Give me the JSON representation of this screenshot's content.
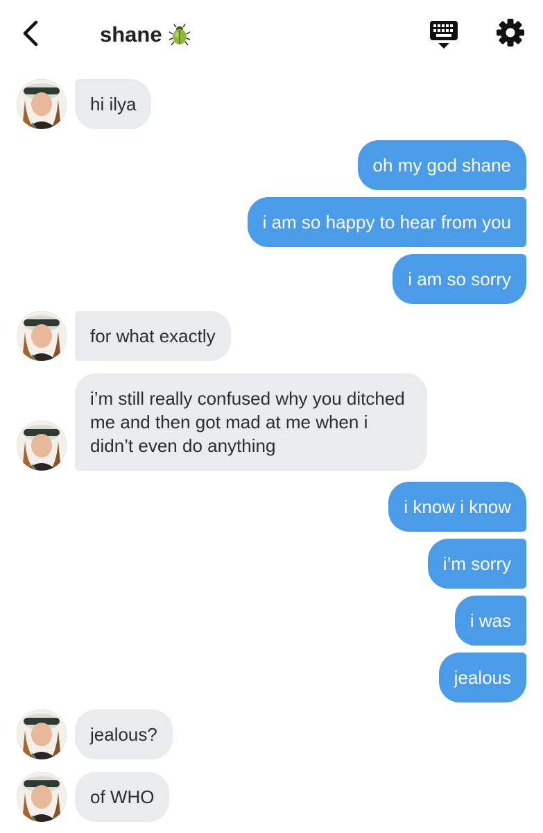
{
  "header": {
    "back_icon": "chevron-left-icon",
    "title": "shane",
    "title_emoji_icon": "beetle-icon",
    "keyboard_icon": "keyboard-icon",
    "settings_icon": "gear-icon"
  },
  "messages": [
    {
      "from": "them",
      "text": "hi ilya"
    },
    {
      "from": "me",
      "text": "oh my god shane"
    },
    {
      "from": "me",
      "text": "i am so happy to hear from you"
    },
    {
      "from": "me",
      "text": "i am so sorry"
    },
    {
      "from": "them",
      "text": "for what exactly"
    },
    {
      "from": "them",
      "text": "i’m still really confused why you ditched me and then got mad at me when i didn’t even do anything"
    },
    {
      "from": "me",
      "text": "i know i know"
    },
    {
      "from": "me",
      "text": "i’m sorry"
    },
    {
      "from": "me",
      "text": "i was"
    },
    {
      "from": "me",
      "text": "jealous"
    },
    {
      "from": "them",
      "text": "jealous?"
    },
    {
      "from": "them",
      "text": "of WHO"
    }
  ],
  "colors": {
    "incoming_bubble": "#e9ebef",
    "outgoing_bubble": "#4a9be8",
    "outgoing_text": "#ffffff"
  }
}
